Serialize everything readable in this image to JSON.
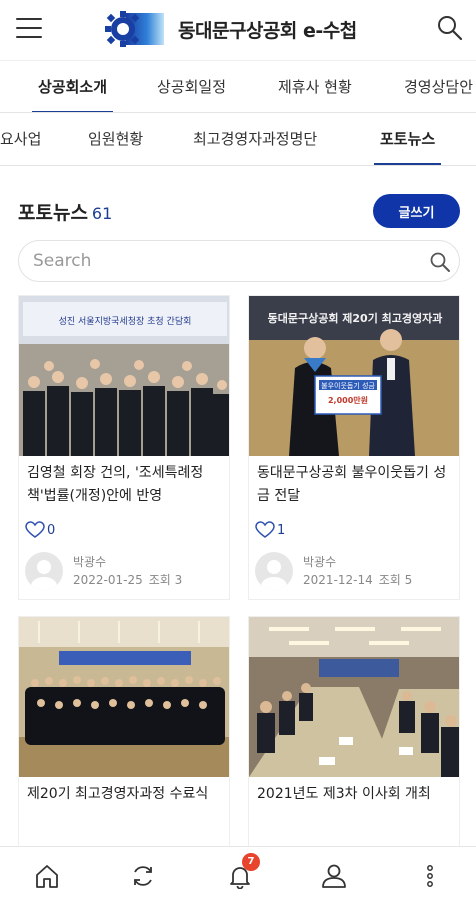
{
  "header": {
    "title": "동대문구상공회 e-수첩",
    "logo_icon": "gear-logo-icon",
    "menu_icon": "hamburger-menu-icon",
    "search_icon": "search-icon"
  },
  "tabs_primary": [
    {
      "label": "상공회소개",
      "active": true
    },
    {
      "label": "상공회일정",
      "active": false
    },
    {
      "label": "제휴사 현황",
      "active": false
    },
    {
      "label": "경영상담안",
      "active": false
    }
  ],
  "tabs_secondary": [
    {
      "label": "요사업",
      "active": false
    },
    {
      "label": "임원현황",
      "active": false
    },
    {
      "label": "최고경영자과정명단",
      "active": false
    },
    {
      "label": "포토뉴스",
      "active": true
    }
  ],
  "section": {
    "title": "포토뉴스",
    "count": "61",
    "write_button": "글쓰기"
  },
  "search": {
    "placeholder": "Search"
  },
  "posts": [
    {
      "title": "김영철 회장 건의, '조세특례정책'법률(개정)안에 반영",
      "thumb_banner": "성진 서울지방국세청장 초청 간담회",
      "likes": "0",
      "author": "박광수",
      "date": "2022-01-25",
      "views": "조회 3"
    },
    {
      "title": "동대문구상공회 불우이웃돕기 성금 전달",
      "thumb_banner": "동대문구상공회 제20기 최고경영자과",
      "thumb_sign": "불우이웃돕기 성금",
      "thumb_amount": "2,000만원",
      "likes": "1",
      "author": "박광수",
      "date": "2021-12-14",
      "views": "조회 5"
    },
    {
      "title": "제20기 최고경영자과정 수료식",
      "likes": "",
      "author": "",
      "date": "",
      "views": ""
    },
    {
      "title": "2021년도 제3차 이사회 개최",
      "likes": "",
      "author": "",
      "date": "",
      "views": ""
    }
  ],
  "bottom_nav": [
    {
      "icon": "home-icon"
    },
    {
      "icon": "refresh-icon"
    },
    {
      "icon": "bell-icon",
      "badge": "7"
    },
    {
      "icon": "user-icon"
    },
    {
      "icon": "more-vertical-icon"
    }
  ],
  "colors": {
    "primary": "#0f35a8",
    "accent_text": "#1c3f94",
    "badge": "#e8432c"
  }
}
